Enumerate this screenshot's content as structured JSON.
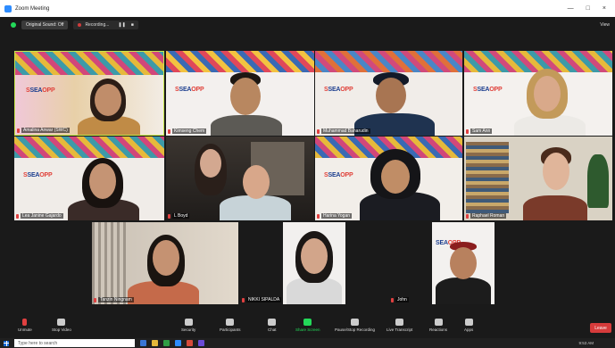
{
  "window": {
    "title": "Zoom Meeting",
    "minimize": "—",
    "maximize": "□",
    "close": "×"
  },
  "top_toolbar": {
    "original_sound": "Original Sound: Off",
    "recording": "Recording...",
    "view": "View"
  },
  "participants": [
    {
      "name": "Amalina Anwar (SWC)",
      "logo": true
    },
    {
      "name": "Kimseng Chem",
      "logo": true
    },
    {
      "name": "Muhammad Baharudin",
      "logo": true
    },
    {
      "name": "Sam Ann",
      "logo": true
    },
    {
      "name": "Lea Janine Gajardo",
      "logo": true
    },
    {
      "name": "L Boyd",
      "logo": false
    },
    {
      "name": "Harina Yogan",
      "logo": true
    },
    {
      "name": "Raphael Roman",
      "logo": false
    },
    {
      "name": "Tanzin Ningnam",
      "logo": false
    },
    {
      "name": "NIKKI SIPALDA",
      "logo": false
    },
    {
      "name": "John",
      "logo": false
    }
  ],
  "brand": {
    "prefix": "S",
    "main": "SEA",
    "suffix": "OPP"
  },
  "bottom_toolbar": {
    "unmute": "Unmute",
    "stop_video": "Stop Video",
    "security": "Security",
    "participants": "Participants",
    "participants_count": "10",
    "chat": "Chat",
    "share_screen": "Share Screen",
    "pause_stop_recording": "Pause/Stop Recording",
    "live_transcript": "Live Transcript",
    "reactions": "Reactions",
    "apps": "Apps",
    "leave": "Leave"
  },
  "taskbar": {
    "search_placeholder": "Type here to search",
    "time": "9:53 AM",
    "date": "..."
  },
  "colors": {
    "accent_green": "#23d959",
    "leave_red": "#d63b3b",
    "zoom_blue": "#2d8cff"
  }
}
